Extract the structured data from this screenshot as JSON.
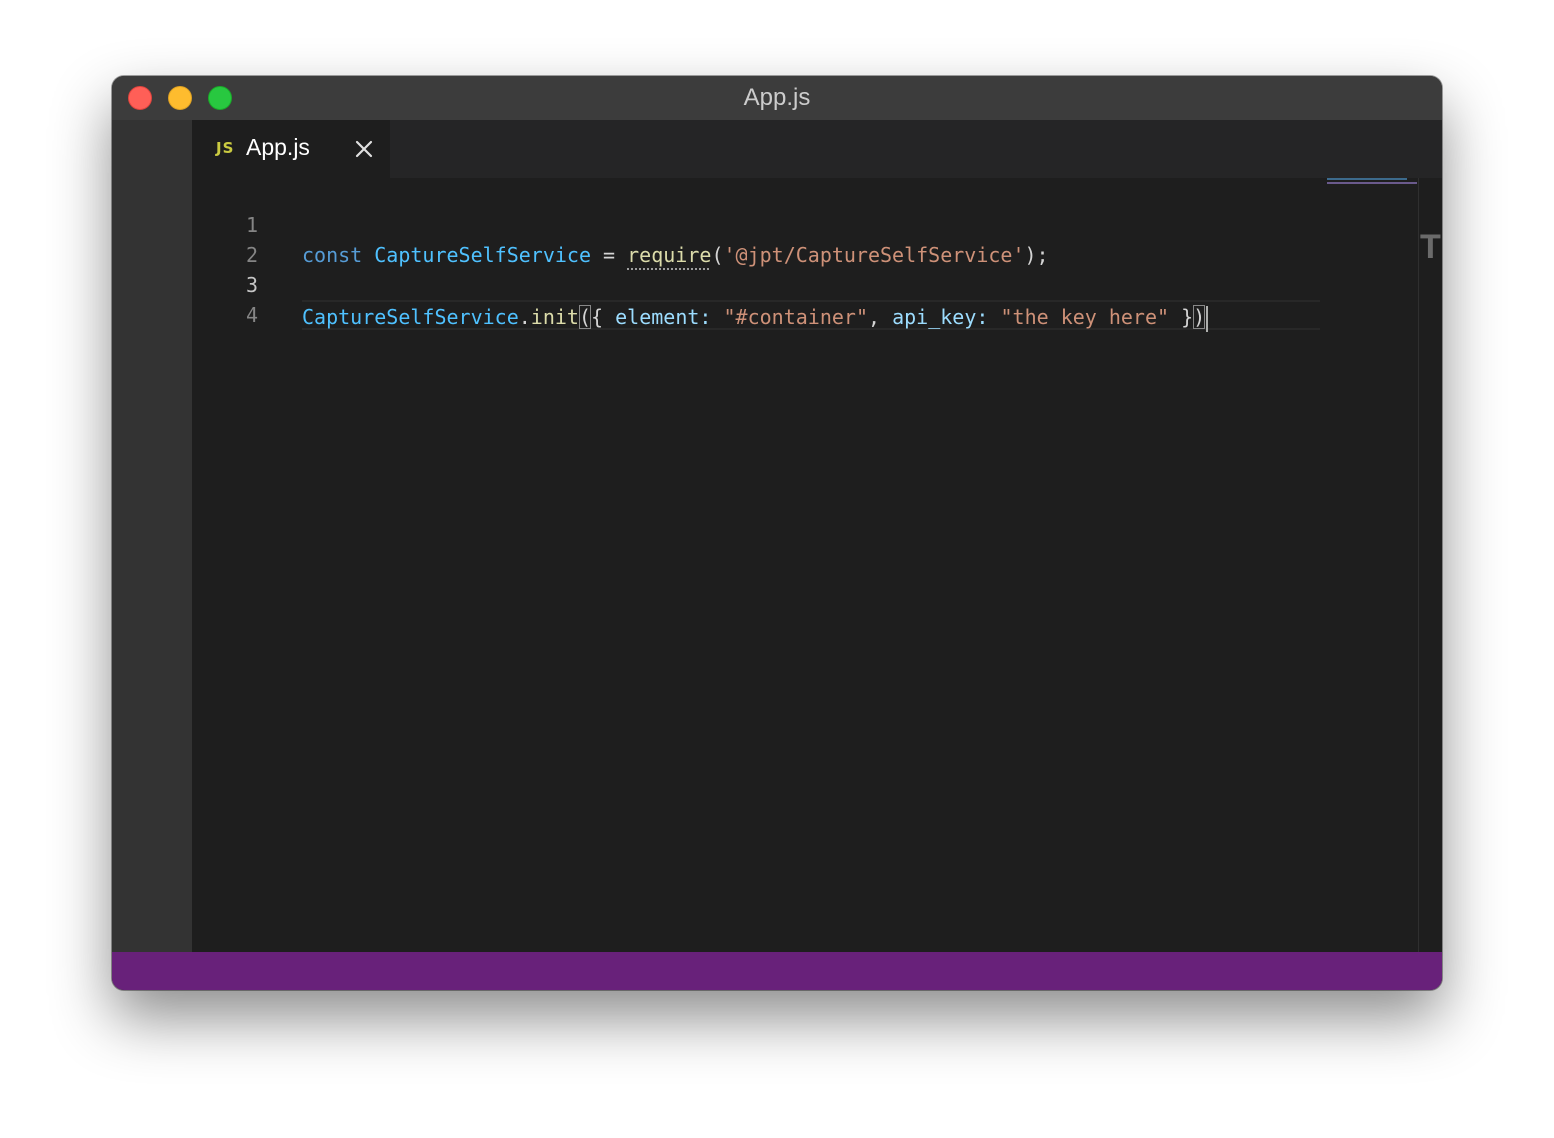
{
  "window": {
    "title": "App.js"
  },
  "tab": {
    "icon": "JS",
    "label": "App.js",
    "close_icon": "close-icon"
  },
  "editor": {
    "line_numbers": [
      "1",
      "2",
      "3",
      "4"
    ],
    "active_line": "3",
    "lines": [
      [
        {
          "t": "kw",
          "v": "const"
        },
        {
          "t": "punc",
          "v": " "
        },
        {
          "t": "cls",
          "v": "CaptureSelfService"
        },
        {
          "t": "punc",
          "v": " = "
        },
        {
          "t": "fn dots",
          "v": "require"
        },
        {
          "t": "punc",
          "v": "("
        },
        {
          "t": "str",
          "v": "'@jpt/CaptureSelfService'"
        },
        {
          "t": "punc",
          "v": ");"
        }
      ],
      [],
      [
        {
          "t": "cls",
          "v": "CaptureSelfService"
        },
        {
          "t": "punc",
          "v": "."
        },
        {
          "t": "fn",
          "v": "init"
        },
        {
          "t": "punc bracket-match",
          "v": "("
        },
        {
          "t": "punc",
          "v": "{ "
        },
        {
          "t": "prop",
          "v": "element"
        },
        {
          "t": "prop",
          "v": ": "
        },
        {
          "t": "str",
          "v": "\"#container\""
        },
        {
          "t": "punc",
          "v": ", "
        },
        {
          "t": "prop",
          "v": "api_key"
        },
        {
          "t": "prop",
          "v": ": "
        },
        {
          "t": "str",
          "v": "\"the key here\""
        },
        {
          "t": "punc",
          "v": " }"
        },
        {
          "t": "punc bracket-match",
          "v": ")"
        }
      ],
      []
    ]
  },
  "colors": {
    "statusbar": "#68217a",
    "editor_bg": "#1e1e1e",
    "keyword": "#569cd6",
    "class": "#4fc1ff",
    "function": "#dcdcaa",
    "string": "#ce9178",
    "property": "#9cdcfe"
  }
}
